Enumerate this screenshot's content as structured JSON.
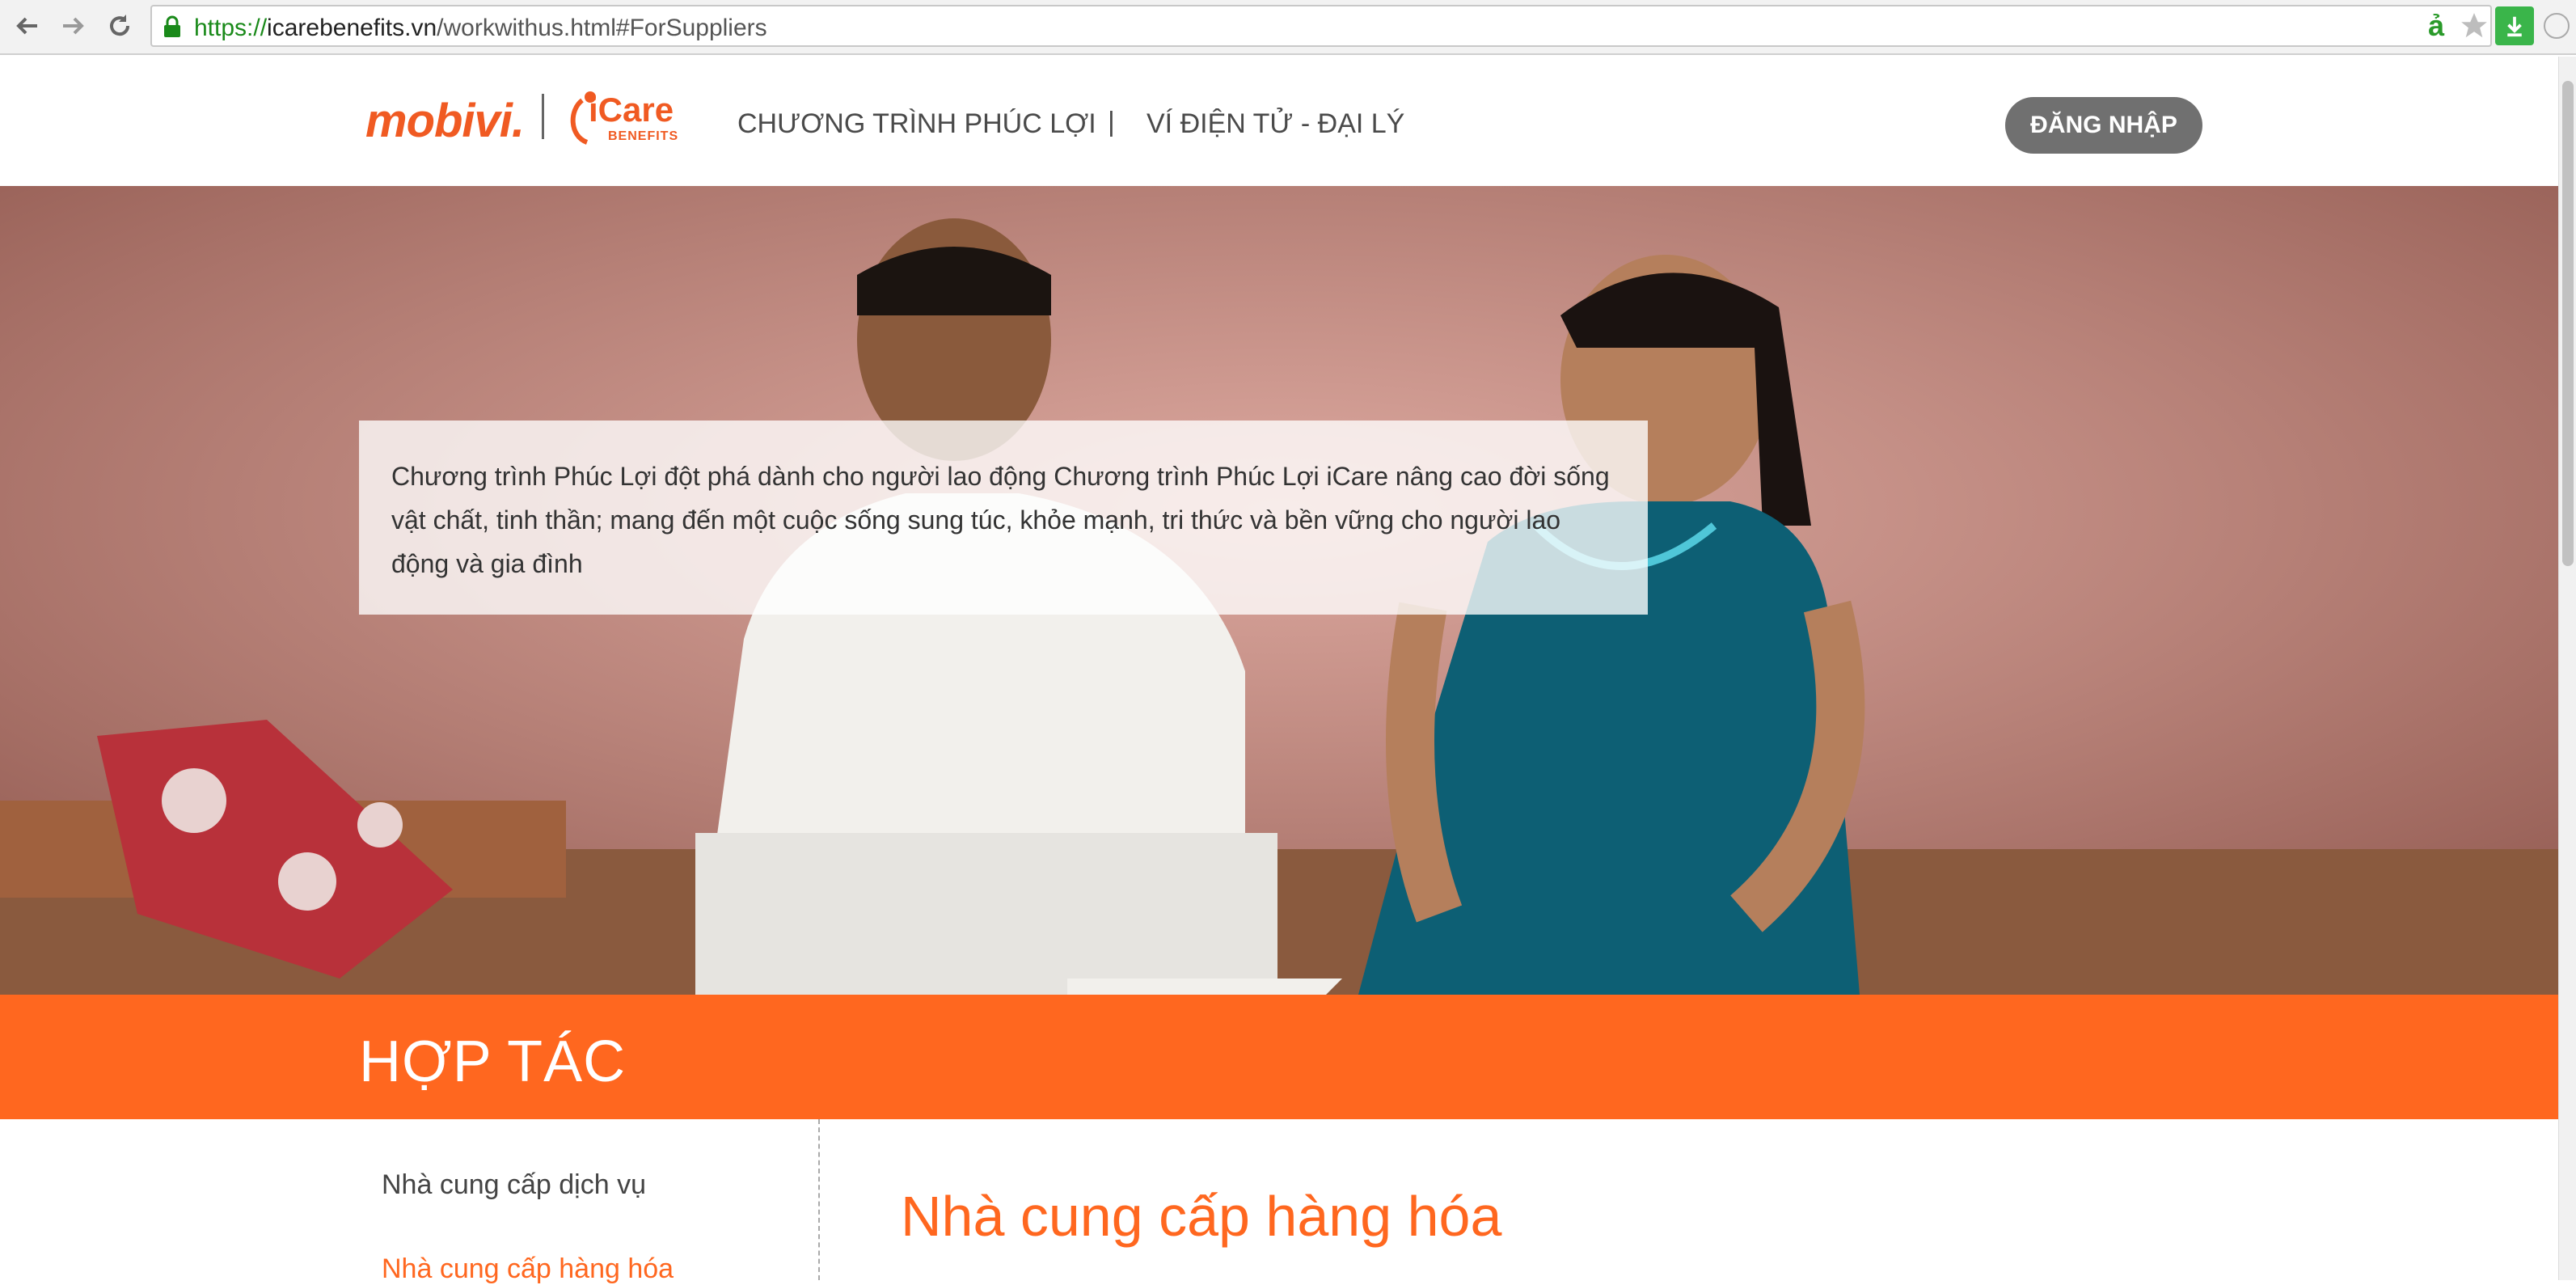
{
  "browser": {
    "url_secure": "https://",
    "url_domain": "icarebenefits.vn",
    "url_path": "/workwithus.html#ForSuppliers",
    "icons": [
      "back-arrow-icon",
      "forward-arrow-icon",
      "reload-icon",
      "lock-icon",
      "extension-icon",
      "star-icon",
      "download-icon"
    ],
    "accent_secure": "#1a8a1a"
  },
  "header": {
    "logo_mobivi": "mobivi.",
    "logo_icare": "iCare",
    "logo_icare_sub": "BENEFITS",
    "nav": [
      {
        "label": "CHƯƠNG TRÌNH PHÚC LỢI"
      },
      {
        "label": "VÍ ĐIỆN TỬ - ĐẠI LÝ"
      }
    ],
    "nav_divider": "|",
    "login_label": "ĐĂNG NHẬP"
  },
  "hero": {
    "caption": "Chương trình Phúc Lợi đột phá dành cho người lao động Chương trình Phúc Lợi iCare nâng cao đời sống vật chất, tinh thần; mang đến một cuộc sống sung túc, khỏe mạnh, tri thức và bền vững cho người lao động và gia đình"
  },
  "section": {
    "title": "HỢP TÁC",
    "color": "#ff671f"
  },
  "sidebar": {
    "items": [
      {
        "label": "Nhà cung cấp dịch vụ"
      },
      {
        "label": "Nhà cung cấp hàng hóa"
      }
    ]
  },
  "main": {
    "title": "Nhà cung cấp hàng hóa"
  }
}
